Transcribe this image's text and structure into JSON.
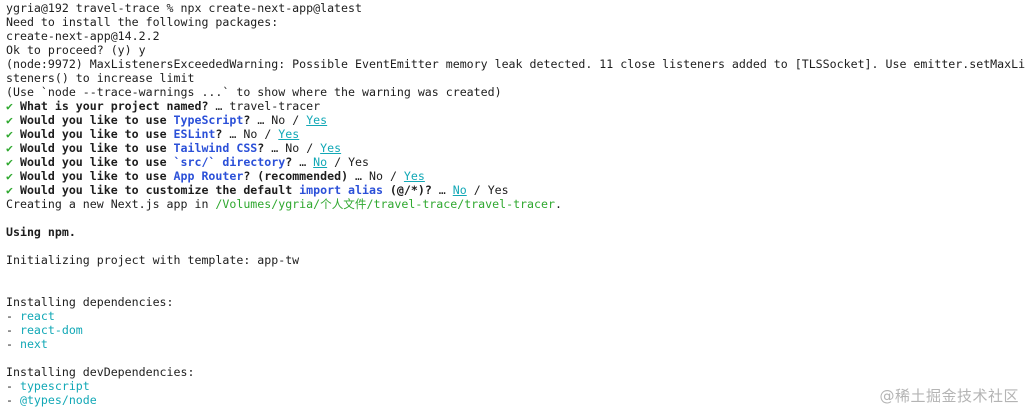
{
  "terminal": {
    "prompt_line": "ygria@192 travel-trace % npx create-next-app@latest",
    "install_notice": "Need to install the following packages:",
    "package_spec": "create-next-app@14.2.2",
    "proceed_prompt": "Ok to proceed? (y) y",
    "warning_line_1": "(node:9972) MaxListenersExceededWarning: Possible EventEmitter memory leak detected. 11 close listeners added to [TLSSocket]. Use emitter.setMaxLi",
    "warning_line_2": "steners() to increase limit",
    "warning_line_3": "(Use `node --trace-warnings ...` to show where the warning was created)",
    "check_mark": "✔",
    "ellipsis": "…",
    "q1": {
      "text": "What is your project named?",
      "answer": "travel-tracer"
    },
    "q2": {
      "pre": "Would you like to use ",
      "highlight": "TypeScript",
      "post": "?",
      "no": "No",
      "sep": "/",
      "yes": "Yes"
    },
    "q3": {
      "pre": "Would you like to use ",
      "highlight": "ESLint",
      "post": "?",
      "no": "No",
      "sep": "/",
      "yes": "Yes"
    },
    "q4": {
      "pre": "Would you like to use ",
      "highlight": "Tailwind CSS",
      "post": "?",
      "no": "No",
      "sep": "/",
      "yes": "Yes"
    },
    "q5": {
      "pre": "Would you like to use ",
      "highlight": "`src/` directory",
      "post": "?",
      "no": "No",
      "sep": "/",
      "yes": "Yes"
    },
    "q6": {
      "pre": "Would you like to use ",
      "highlight": "App Router",
      "post": "? (recommended)",
      "no": "No",
      "sep": "/",
      "yes": "Yes"
    },
    "q7": {
      "pre": "Would you like to customize the default ",
      "highlight": "import alias",
      "post": " (@/*)?",
      "no": "No",
      "sep": "/",
      "yes": "Yes"
    },
    "creating_prefix": "Creating a new Next.js app in ",
    "creating_path": "/Volumes/ygria/个人文件/travel-trace/travel-tracer",
    "creating_suffix": ".",
    "using_npm": "Using npm.",
    "initializing": "Initializing project with template: app-tw",
    "deps_header": "Installing dependencies:",
    "dependencies": [
      "react",
      "react-dom",
      "next"
    ],
    "dev_deps_header": "Installing devDependencies:",
    "dev_dependencies": [
      "typescript",
      "@types/node"
    ],
    "dash": "-"
  },
  "watermark": "@稀土掘金技术社区",
  "colors": {
    "background": "#ffffff",
    "text": "#1d1d1d",
    "check_green": "#2fa82f",
    "highlight_blue": "#2b50d8",
    "selected_cyan": "#12a8b6"
  }
}
